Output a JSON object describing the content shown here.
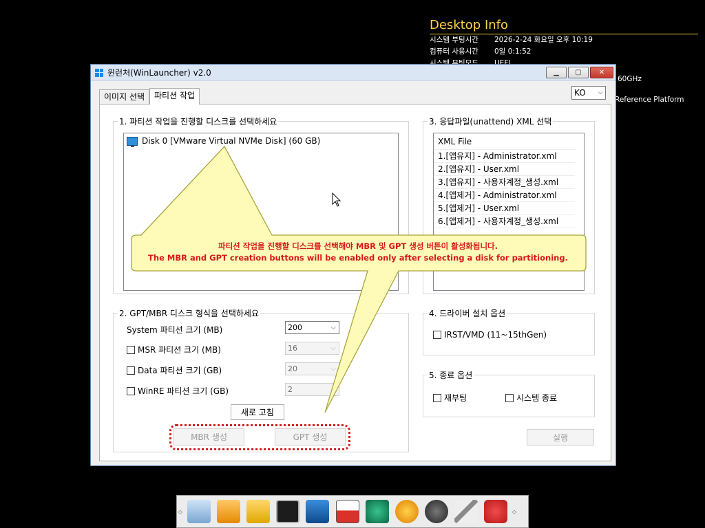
{
  "desktop_info": {
    "title": "Desktop Info",
    "rows": [
      {
        "key": "시스템 부팅시간",
        "value": "2026-2-24 화요일 오후 10:19"
      },
      {
        "key": "컴퓨터 사용시간",
        "value": "0일 0:1:52"
      },
      {
        "key": "시스템 부팅모드",
        "value": "UEFI"
      }
    ],
    "extra1": "60GHz",
    "extra2": "Reference Platform"
  },
  "window": {
    "title": "윈런처(WinLauncher) v2.0",
    "tabs": [
      "이미지 선택",
      "파티션 작업"
    ],
    "language": "KO"
  },
  "disk_group": {
    "legend": "1. 파티션 작업을 진행할 디스크를 선택하세요",
    "disks": [
      "Disk 0 [VMware Virtual NVMe Disk] (60 GB)"
    ]
  },
  "xml_group": {
    "legend": "3. 응답파일(unattend) XML 선택",
    "header": "XML File",
    "items": [
      "1.[앱유지] - Administrator.xml",
      "2.[앱유지] - User.xml",
      "3.[앱유지] - 사용자계정_생성.xml",
      "4.[앱제거] - Administrator.xml",
      "5.[앱제거] - User.xml",
      "6.[앱제거] - 사용자계정_생성.xml"
    ]
  },
  "format_group": {
    "legend": "2. GPT/MBR 디스크 형식을 선택하세요",
    "system_label": "System 파티션 크기 (MB)",
    "system_value": "200",
    "msr_label": "MSR 파티션 크기 (MB)",
    "msr_value": "16",
    "data_label": "Data 파티션 크기 (GB)",
    "data_value": "20",
    "winre_label": "WinRE 파티션 크기 (GB)",
    "winre_value": "2",
    "refresh_label": "새로 고침",
    "mbr_label": "MBR 생성",
    "gpt_label": "GPT 생성"
  },
  "driver_group": {
    "legend": "4. 드라이버 설치 옵션",
    "irst_label": "IRST/VMD (11~15thGen)"
  },
  "exit_group": {
    "legend": "5. 종료 옵션",
    "reboot_label": "재부팅",
    "shutdown_label": "시스템 종료"
  },
  "run_label": "실행",
  "callout": {
    "line1": "파티션 작업을 진행할 디스크를 선택해야 MBR 및 GPT 생성 버튼이 활성화됩니다.",
    "line2": "The MBR and GPT creation buttons will be enabled only after selecting a disk for partitioning."
  },
  "colors": {
    "callout_fill": "#fdfbb7",
    "callout_text": "#d7191c",
    "accent": "#ffd24a"
  },
  "taskbar_icons": [
    "disk-image-icon",
    "usb-drive-icon",
    "folder-search-icon",
    "terminal-icon",
    "monitor-icon",
    "partition-tool-icon",
    "disk-health-icon",
    "sync-icon",
    "settings-gear-icon",
    "tools-icon",
    "power-icon"
  ]
}
